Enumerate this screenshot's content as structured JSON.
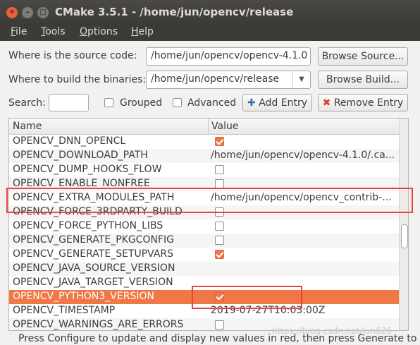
{
  "window": {
    "title": "CMake 3.5.1 - /home/jun/opencv/release"
  },
  "menu": [
    {
      "label": "File",
      "mnemonic": "F",
      "rest": "ile"
    },
    {
      "label": "Tools",
      "mnemonic": "T",
      "rest": "ools"
    },
    {
      "label": "Options",
      "mnemonic": "O",
      "rest": "ptions"
    },
    {
      "label": "Help",
      "mnemonic": "H",
      "rest": "elp"
    }
  ],
  "source": {
    "label": "Where is the source code:",
    "value": "/home/jun/opencv/opencv-4.1.0",
    "browse_label": "Browse Source..."
  },
  "build": {
    "label": "Where to build the binaries:",
    "value": "/home/jun/opencv/release",
    "browse_label": "Browse Build..."
  },
  "search": {
    "label": "Search:",
    "value": ""
  },
  "options": {
    "grouped_label": "Grouped",
    "grouped_checked": false,
    "advanced_label": "Advanced",
    "advanced_checked": false,
    "add_entry_label": "Add Entry",
    "remove_entry_label": "Remove Entry"
  },
  "table": {
    "columns": [
      "Name",
      "Value"
    ],
    "rows": [
      {
        "name": "OPENCV_DNN_OPENCL",
        "type": "bool",
        "checked": true
      },
      {
        "name": "OPENCV_DOWNLOAD_PATH",
        "type": "text",
        "value": "/home/jun/opencv/opencv-4.1.0/.ca..."
      },
      {
        "name": "OPENCV_DUMP_HOOKS_FLOW",
        "type": "bool",
        "checked": false
      },
      {
        "name": "OPENCV_ENABLE_NONFREE",
        "type": "bool",
        "checked": false
      },
      {
        "name": "OPENCV_EXTRA_MODULES_PATH",
        "type": "text",
        "value": "/home/jun/opencv/opencv_contrib-..."
      },
      {
        "name": "OPENCV_FORCE_3RDPARTY_BUILD",
        "type": "bool",
        "checked": false
      },
      {
        "name": "OPENCV_FORCE_PYTHON_LIBS",
        "type": "bool",
        "checked": false
      },
      {
        "name": "OPENCV_GENERATE_PKGCONFIG",
        "type": "bool",
        "checked": false
      },
      {
        "name": "OPENCV_GENERATE_SETUPVARS",
        "type": "bool",
        "checked": true
      },
      {
        "name": "OPENCV_JAVA_SOURCE_VERSION",
        "type": "text",
        "value": ""
      },
      {
        "name": "OPENCV_JAVA_TARGET_VERSION",
        "type": "text",
        "value": ""
      },
      {
        "name": "OPENCV_PYTHON3_VERSION",
        "type": "bool",
        "checked": true,
        "selected": true
      },
      {
        "name": "OPENCV_TIMESTAMP",
        "type": "text",
        "value": "2019-07-27T10:03:00Z"
      },
      {
        "name": "OPENCV_WARNINGS_ARE_ERRORS",
        "type": "bool",
        "checked": false
      }
    ]
  },
  "status": {
    "text": "Press Configure to update and display new values in red, then press Generate to"
  },
  "watermark": "https://blog.csdn.net/Jun626",
  "colors": {
    "selection": "#f07746",
    "annotation": "#e8433e"
  }
}
